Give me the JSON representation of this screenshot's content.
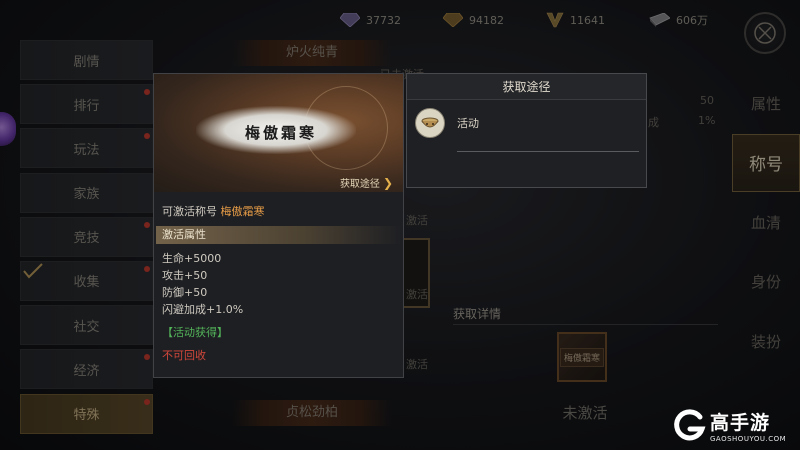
{
  "currencies": [
    {
      "icon": "purple-diamond-icon",
      "value": "37732",
      "color": "#8a7aa8"
    },
    {
      "icon": "gold-diamond-icon",
      "value": "94182",
      "color": "#9a7a3a"
    },
    {
      "icon": "v-badge-icon",
      "value": "11641",
      "color": "#a08a4a"
    },
    {
      "icon": "silver-ingot-icon",
      "value": "606万",
      "color": "#8c8c90"
    }
  ],
  "left_nav": [
    {
      "label": "剧情",
      "dot": false,
      "active": false
    },
    {
      "label": "排行",
      "dot": true,
      "active": false
    },
    {
      "label": "玩法",
      "dot": true,
      "active": false
    },
    {
      "label": "家族",
      "dot": false,
      "active": false
    },
    {
      "label": "竞技",
      "dot": true,
      "active": false
    },
    {
      "label": "收集",
      "dot": true,
      "active": false
    },
    {
      "label": "社交",
      "dot": false,
      "active": false
    },
    {
      "label": "经济",
      "dot": true,
      "active": false
    },
    {
      "label": "特殊",
      "dot": true,
      "active": true
    }
  ],
  "right_nav": [
    {
      "label": "属性",
      "active": false
    },
    {
      "label": "称号",
      "active": true
    },
    {
      "label": "血清",
      "active": false
    },
    {
      "label": "身份",
      "active": false
    },
    {
      "label": "装扮",
      "active": false
    }
  ],
  "background": {
    "banner_top": "炉火纯青",
    "banner_bottom": "贞松劲柏",
    "col_head": "已未激活",
    "stat_value": "50",
    "stat_percent": "1%",
    "stat_label": "成",
    "activate_1": "激活",
    "activate_2": "激活",
    "activate_3": "激活",
    "detail_tab": "获取详情",
    "card_label": "梅傲霜寒",
    "inactive_label": "未激活"
  },
  "tooltip": {
    "art_title": "梅傲霜寒",
    "get_path_label": "获取途径",
    "activatable_prefix": "可激活称号",
    "title_name": "梅傲霜寒",
    "attr_header": "激活属性",
    "attributes": [
      "生命+5000",
      "攻击+50",
      "防御+50",
      "闪避加成+1.0%"
    ],
    "source": "【活动获得】",
    "recycle": "不可回收"
  },
  "acquisition": {
    "header": "获取途径",
    "item_label": "活动"
  },
  "watermark": {
    "brand": "高手游",
    "url": "GAOSHOUYOU.COM"
  }
}
